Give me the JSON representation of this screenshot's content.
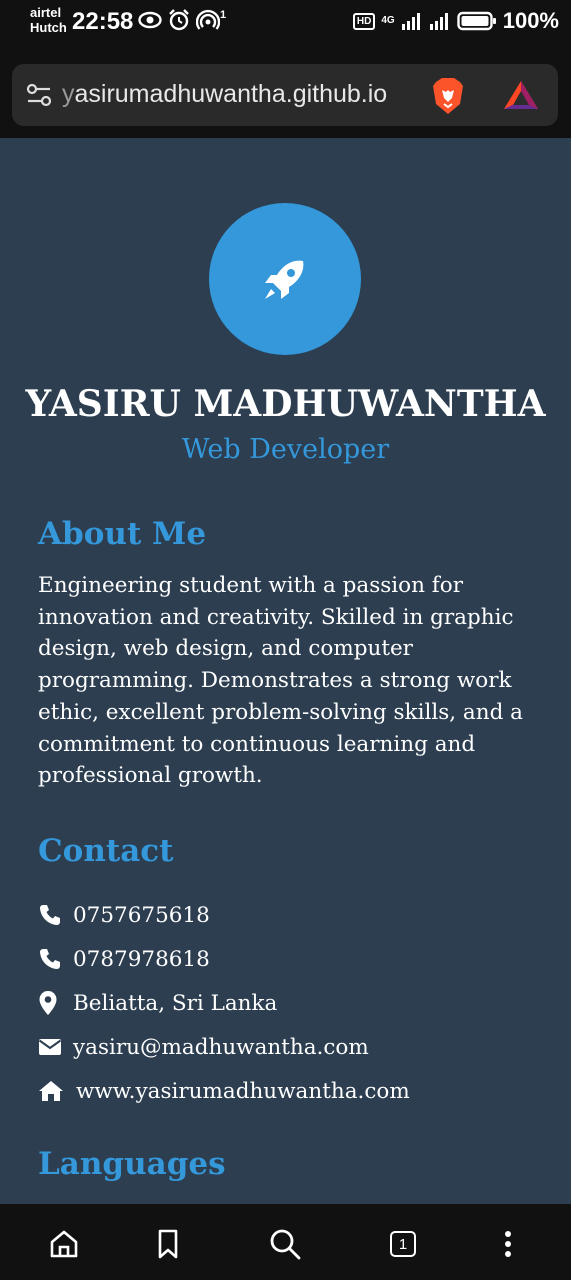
{
  "status_bar": {
    "carrier_line1": "airtel",
    "carrier_line2": "Hutch",
    "time": "22:58",
    "hotspot_count": "1",
    "hd_label": "HD",
    "network_label": "4G",
    "battery": "100%"
  },
  "browser": {
    "url_prefix": "y",
    "url_rest": "asirumadhuwantha.github.io",
    "tab_count": "1"
  },
  "profile": {
    "name": "YASIRU MADHUWANTHA",
    "role": "Web Developer"
  },
  "about": {
    "title": "About Me",
    "text": "Engineering student with a passion for innovation and creativity. Skilled in graphic design, web design, and computer programming. Demonstrates a strong work ethic, excellent problem-solving skills, and a commitment to continuous learning and professional growth."
  },
  "contact": {
    "title": "Contact",
    "items": [
      {
        "icon": "phone-icon",
        "text": "0757675618"
      },
      {
        "icon": "phone-icon",
        "text": "0787978618"
      },
      {
        "icon": "location-pin-icon",
        "text": "Beliatta, Sri Lanka"
      },
      {
        "icon": "envelope-icon",
        "text": "yasiru@madhuwantha.com"
      },
      {
        "icon": "home-icon",
        "text": "www.yasirumadhuwantha.com"
      }
    ]
  },
  "languages": {
    "title": "Languages"
  },
  "colors": {
    "page_bg": "#2c3e50",
    "accent": "#3498db",
    "text": "#ffffff",
    "chrome": "#111111"
  }
}
